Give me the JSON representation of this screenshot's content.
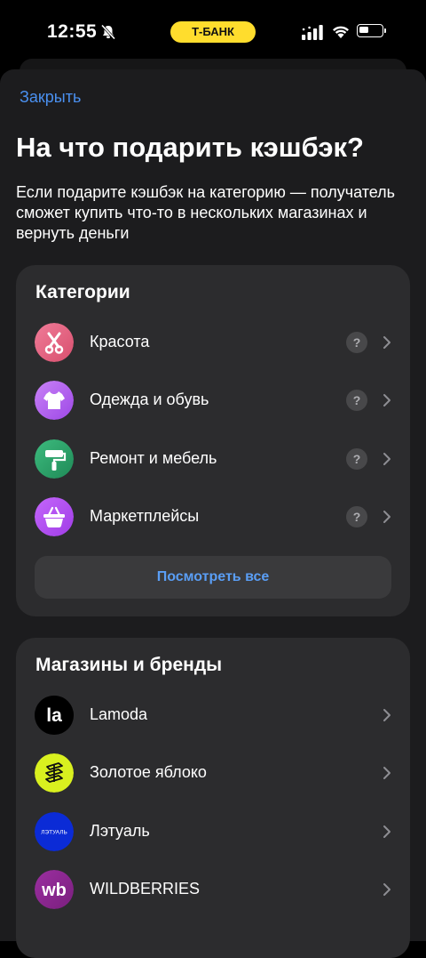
{
  "status_bar": {
    "time": "12:55",
    "bank_label": "Т-БАНК"
  },
  "sheet": {
    "close_label": "Закрыть",
    "title": "На что подарить кэшбэк?",
    "description": "Если подарите кэшбэк на категорию — получатель сможет купить что-то в нескольких магазинах и вернуть деньги"
  },
  "categories": {
    "title": "Категории",
    "items": [
      {
        "label": "Красота",
        "icon": "scissors-icon",
        "help": "?",
        "color": "#e2627f"
      },
      {
        "label": "Одежда и обувь",
        "icon": "tshirt-icon",
        "help": "?",
        "color": "#b360ee"
      },
      {
        "label": "Ремонт и мебель",
        "icon": "paint-roller-icon",
        "help": "?",
        "color": "#2ea36b"
      },
      {
        "label": "Маркетплейсы",
        "icon": "basket-icon",
        "help": "?",
        "color": "#b14ff0"
      }
    ],
    "view_all_label": "Посмотреть все"
  },
  "shops": {
    "title": "Магазины и бренды",
    "items": [
      {
        "label": "Lamoda",
        "logo_text": "la",
        "icon": "lamoda-logo-icon",
        "color": "#000000"
      },
      {
        "label": "Золотое яблоко",
        "icon": "golden-apple-logo-icon",
        "color": "#d9f01f"
      },
      {
        "label": "Лэтуаль",
        "logo_text": "ЛЭТУАЛЬ",
        "icon": "letual-logo-icon",
        "color": "#0b2bd6"
      },
      {
        "label": "WILDBERRIES",
        "logo_text": "wb",
        "icon": "wildberries-logo-icon",
        "color": "#8e2a8c"
      }
    ]
  }
}
